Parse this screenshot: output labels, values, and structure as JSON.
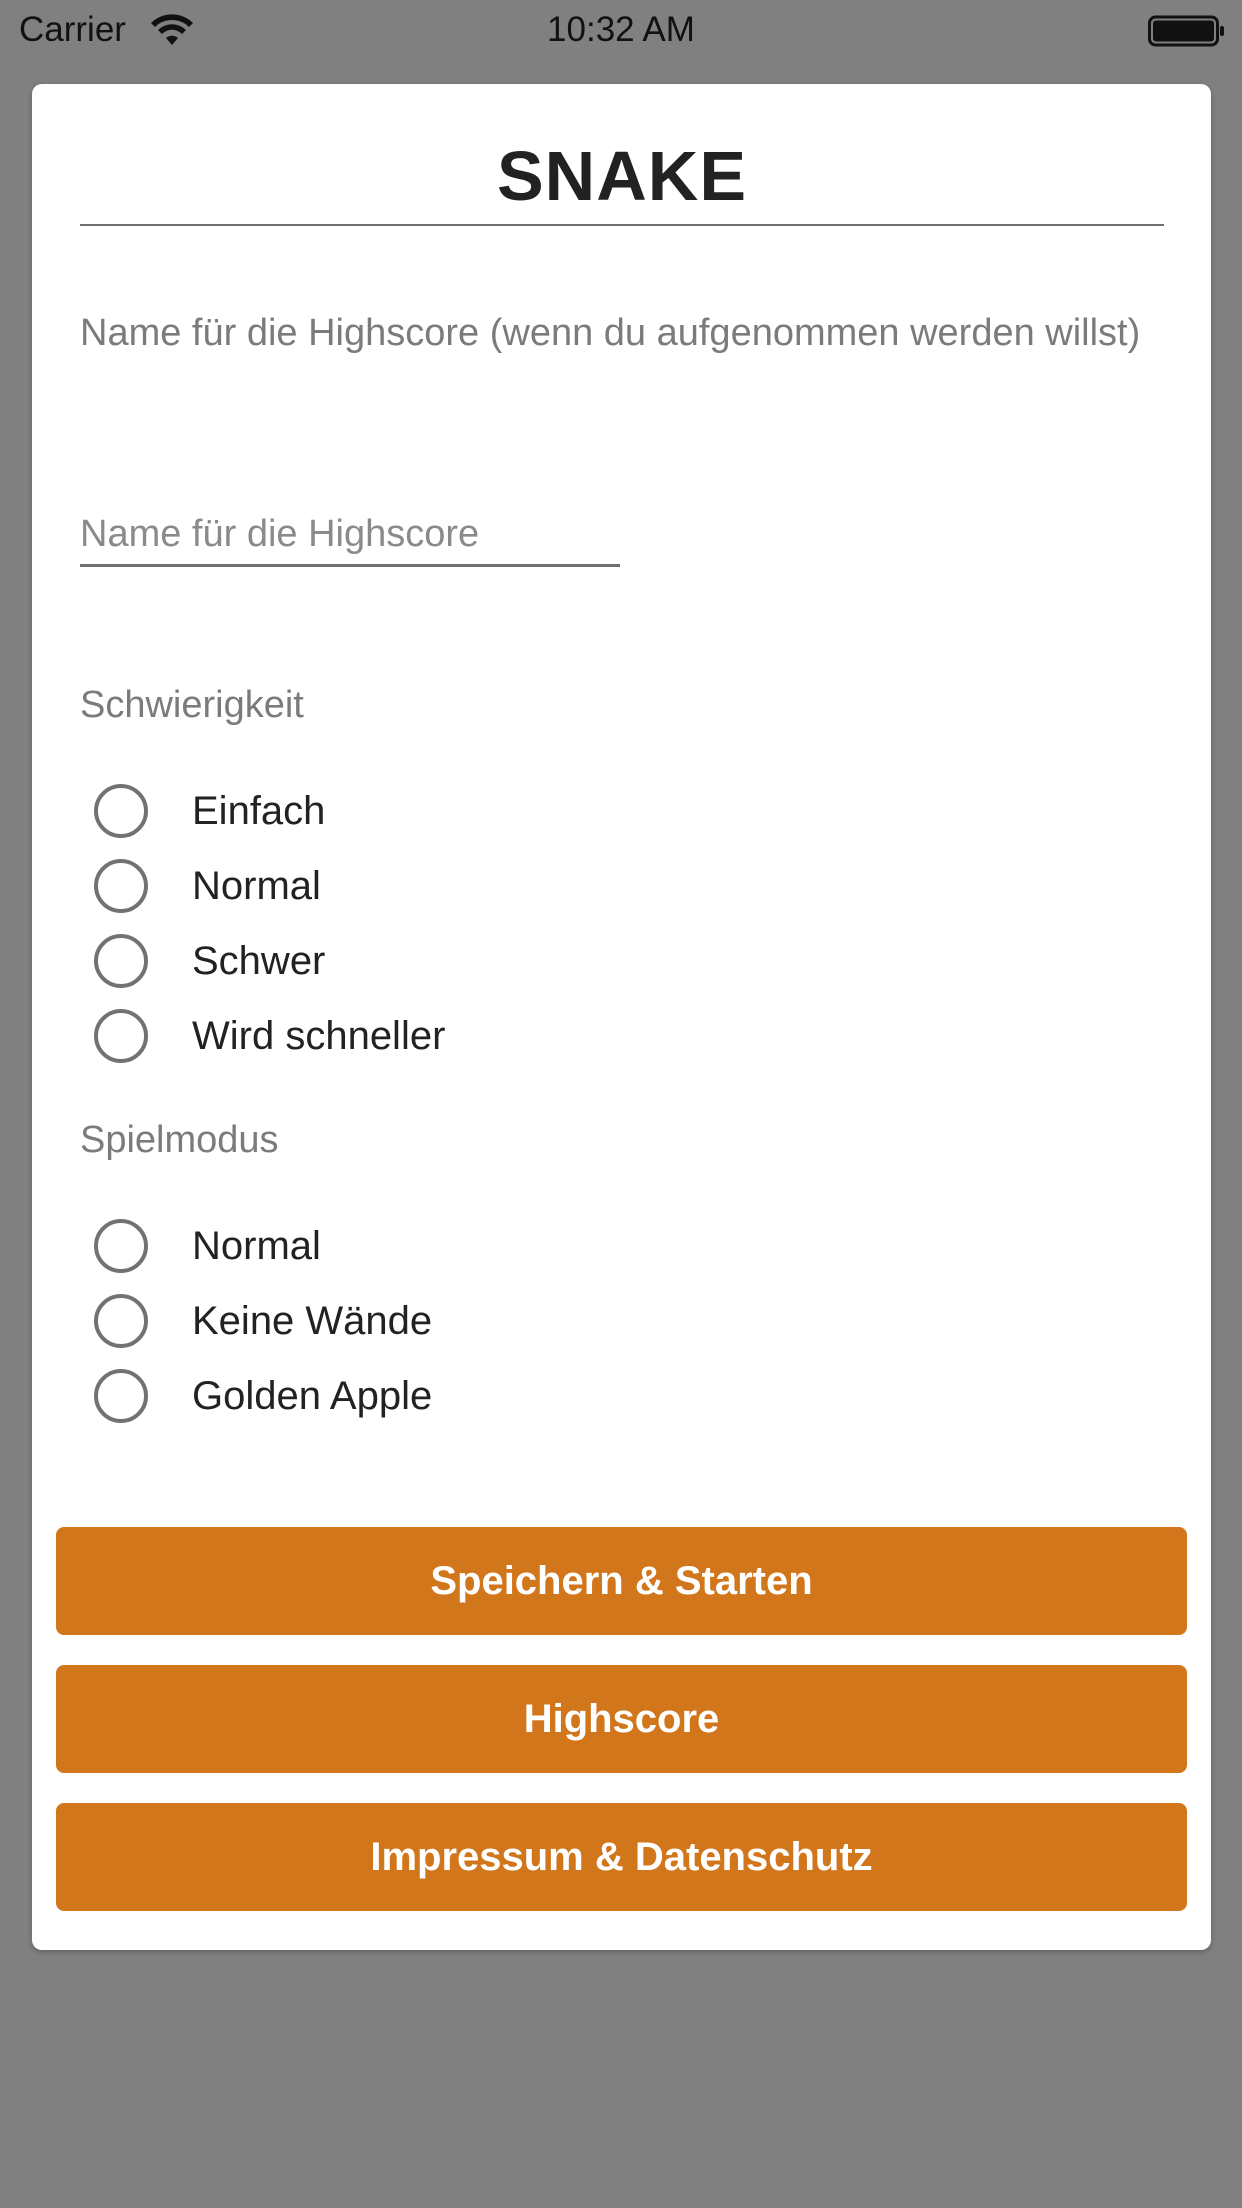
{
  "status_bar": {
    "carrier": "Carrier",
    "time": "10:32 AM"
  },
  "card": {
    "title": "SNAKE",
    "hint": "Name für die Highscore (wenn du aufgenommen werden willst)",
    "name_input": {
      "placeholder": "Name für die Highscore",
      "value": ""
    },
    "difficulty": {
      "label": "Schwierigkeit",
      "options": [
        "Einfach",
        "Normal",
        "Schwer",
        "Wird schneller"
      ]
    },
    "mode": {
      "label": "Spielmodus",
      "options": [
        "Normal",
        "Keine Wände",
        "Golden Apple"
      ]
    },
    "buttons": {
      "save_start": "Speichern & Starten",
      "highscore": "Highscore",
      "imprint": "Impressum & Datenschutz"
    }
  },
  "colors": {
    "background": "#808080",
    "accent": "#d2761c"
  }
}
